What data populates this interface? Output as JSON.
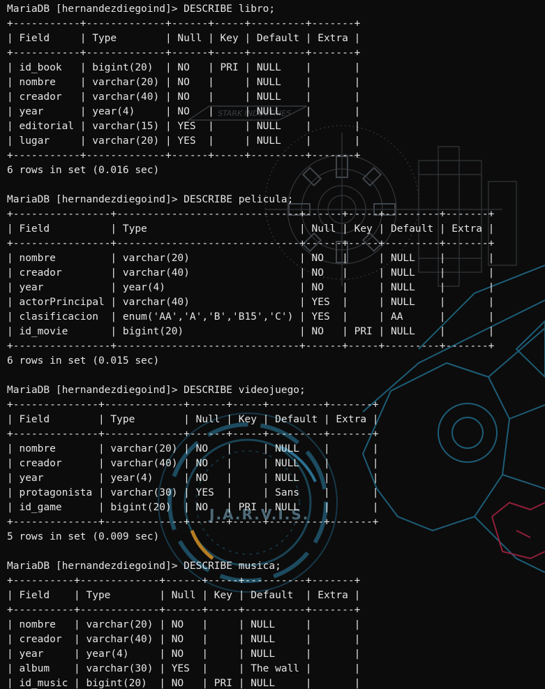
{
  "colors": {
    "background": "#0c0c0c",
    "text": "#e6e6e6",
    "decor_blue": "#2a6f8f",
    "decor_red": "#c0284a",
    "decor_orange": "#d9922a"
  },
  "background_decor": {
    "watermark_text": "J.A.R.V.I.S.",
    "stark_text": "STARK INDUSTRIES"
  },
  "prompt": "MariaDB [hernandezdiegoind]> ",
  "headers": [
    "Field",
    "Type",
    "Null",
    "Key",
    "Default",
    "Extra"
  ],
  "tables": [
    {
      "command": "DESCRIBE libro;",
      "rows": [
        [
          "id_book",
          "bigint(20)",
          "NO",
          "PRI",
          "NULL",
          ""
        ],
        [
          "nombre",
          "varchar(20)",
          "NO",
          "",
          "NULL",
          ""
        ],
        [
          "creador",
          "varchar(40)",
          "NO",
          "",
          "NULL",
          ""
        ],
        [
          "year",
          "year(4)",
          "NO",
          "",
          "NULL",
          ""
        ],
        [
          "editorial",
          "varchar(15)",
          "YES",
          "",
          "NULL",
          ""
        ],
        [
          "lugar",
          "varchar(20)",
          "YES",
          "",
          "NULL",
          ""
        ]
      ],
      "footer": "6 rows in set (0.016 sec)"
    },
    {
      "command": "DESCRIBE pelicula;",
      "rows": [
        [
          "nombre",
          "varchar(20)",
          "NO",
          "",
          "NULL",
          ""
        ],
        [
          "creador",
          "varchar(40)",
          "NO",
          "",
          "NULL",
          ""
        ],
        [
          "year",
          "year(4)",
          "NO",
          "",
          "NULL",
          ""
        ],
        [
          "actorPrincipal",
          "varchar(40)",
          "YES",
          "",
          "NULL",
          ""
        ],
        [
          "clasificacion",
          "enum('AA','A','B','B15','C')",
          "YES",
          "",
          "AA",
          ""
        ],
        [
          "id_movie",
          "bigint(20)",
          "NO",
          "PRI",
          "NULL",
          ""
        ]
      ],
      "footer": "6 rows in set (0.015 sec)"
    },
    {
      "command": "DESCRIBE videojuego;",
      "rows": [
        [
          "nombre",
          "varchar(20)",
          "NO",
          "",
          "NULL",
          ""
        ],
        [
          "creador",
          "varchar(40)",
          "NO",
          "",
          "NULL",
          ""
        ],
        [
          "year",
          "year(4)",
          "NO",
          "",
          "NULL",
          ""
        ],
        [
          "protagonista",
          "varchar(30)",
          "YES",
          "",
          "Sans",
          ""
        ],
        [
          "id_game",
          "bigint(20)",
          "NO",
          "PRI",
          "NULL",
          ""
        ]
      ],
      "footer": "5 rows in set (0.009 sec)"
    },
    {
      "command": "DESCRIBE musica;",
      "rows": [
        [
          "nombre",
          "varchar(20)",
          "NO",
          "",
          "NULL",
          ""
        ],
        [
          "creador",
          "varchar(40)",
          "NO",
          "",
          "NULL",
          ""
        ],
        [
          "year",
          "year(4)",
          "NO",
          "",
          "NULL",
          ""
        ],
        [
          "album",
          "varchar(30)",
          "YES",
          "",
          "The wall",
          ""
        ],
        [
          "id_music",
          "bigint(20)",
          "NO",
          "PRI",
          "NULL",
          ""
        ]
      ],
      "footer": ""
    }
  ]
}
